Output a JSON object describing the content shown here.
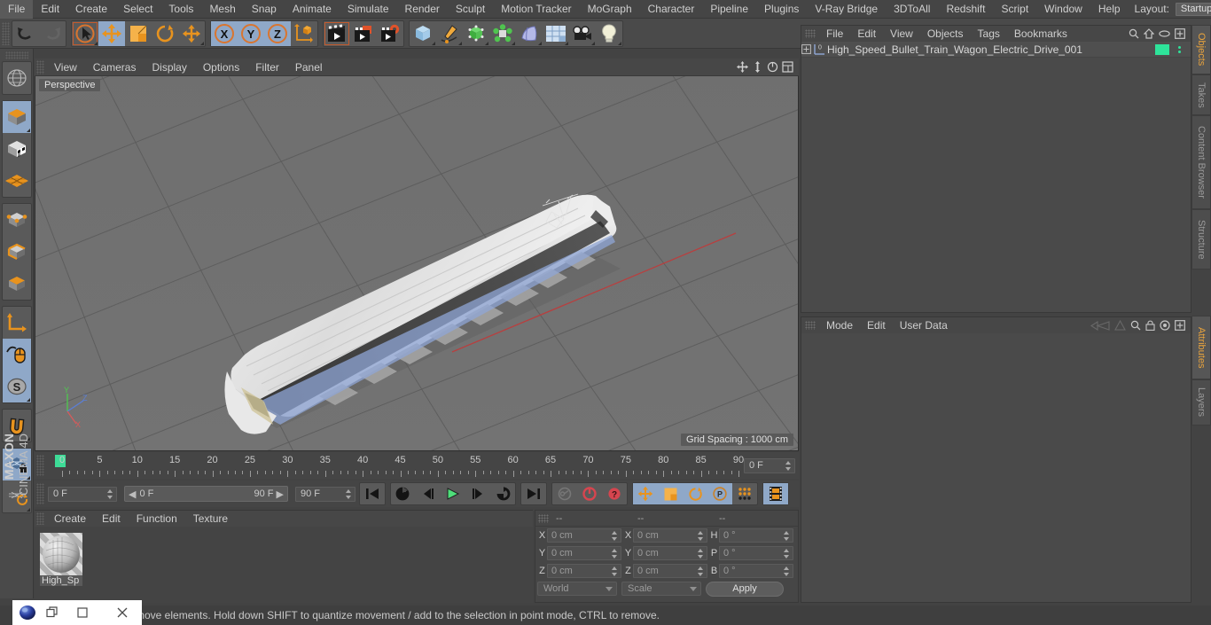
{
  "menubar": {
    "items": [
      "File",
      "Edit",
      "Create",
      "Select",
      "Tools",
      "Mesh",
      "Snap",
      "Animate",
      "Simulate",
      "Render",
      "Sculpt",
      "Motion Tracker",
      "MoGraph",
      "Character",
      "Pipeline",
      "Plugins",
      "V-Ray Bridge",
      "3DToAll",
      "Redshift",
      "Script",
      "Window",
      "Help"
    ],
    "layout_label": "Layout:",
    "layout_value": "Startup",
    "search_icon": "search-icon"
  },
  "toolbar": {
    "groups": [
      {
        "name": "history",
        "buttons": [
          {
            "name": "undo-button",
            "icon": "undo-arrow-icon",
            "state": "normal"
          },
          {
            "name": "redo-button",
            "icon": "redo-arrow-icon",
            "state": "disabled"
          }
        ]
      },
      {
        "name": "tools",
        "buttons": [
          {
            "name": "live-selection-tool",
            "icon": "cursor-circle-icon",
            "state": "selected"
          },
          {
            "name": "move-tool",
            "icon": "move-arrows-icon",
            "state": "active"
          },
          {
            "name": "scale-tool",
            "icon": "scale-box-icon",
            "state": "normal"
          },
          {
            "name": "rotate-tool",
            "icon": "rotate-circle-icon",
            "state": "normal"
          },
          {
            "name": "move-duplicate-tool",
            "icon": "move-arrows-icon",
            "state": "normal"
          }
        ]
      },
      {
        "name": "axis-locks",
        "buttons": [
          {
            "name": "lock-x-axis",
            "icon": "x-axis-icon",
            "state": "active"
          },
          {
            "name": "lock-y-axis",
            "icon": "y-axis-icon",
            "state": "active"
          },
          {
            "name": "lock-z-axis",
            "icon": "z-axis-icon",
            "state": "active"
          },
          {
            "name": "world-object-coordinate",
            "icon": "world-axis-cube-icon",
            "state": "normal"
          }
        ]
      },
      {
        "name": "render",
        "buttons": [
          {
            "name": "render-view-button",
            "icon": "clapperboard-icon",
            "state": "selected"
          },
          {
            "name": "render-to-picture-viewer-button",
            "icon": "clapperboard-orange-icon",
            "state": "normal"
          },
          {
            "name": "edit-render-settings-button",
            "icon": "clapperboard-gear-icon",
            "state": "normal"
          }
        ]
      },
      {
        "name": "create",
        "buttons": [
          {
            "name": "add-cube-button",
            "icon": "blue-cube-icon",
            "state": "normal"
          },
          {
            "name": "add-spline-button",
            "icon": "pen-spline-icon",
            "state": "normal"
          },
          {
            "name": "add-generator-button",
            "icon": "green-cube-icon",
            "state": "normal"
          },
          {
            "name": "add-mograph-button",
            "icon": "green-cluster-icon",
            "state": "normal"
          },
          {
            "name": "add-deformer-button",
            "icon": "purple-bend-icon",
            "state": "normal"
          },
          {
            "name": "add-scene-button",
            "icon": "floor-grid-icon",
            "state": "normal"
          },
          {
            "name": "add-camera-button",
            "icon": "camera-icon",
            "state": "normal"
          },
          {
            "name": "add-light-button",
            "icon": "lightbulb-icon",
            "state": "normal"
          }
        ]
      }
    ]
  },
  "lefttool": {
    "groups": [
      [
        {
          "name": "undo-view-button",
          "icon": "globe-wire-icon",
          "state": "normal"
        }
      ],
      [
        {
          "name": "model-mode-button",
          "icon": "cube-solid-icon",
          "state": "active"
        },
        {
          "name": "texture-mode-button",
          "icon": "cube-checker-icon",
          "state": "normal"
        },
        {
          "name": "workplane-mode-button",
          "icon": "orange-grid-icon",
          "state": "normal"
        }
      ],
      [
        {
          "name": "points-mode-button",
          "icon": "cube-points-icon",
          "state": "normal"
        },
        {
          "name": "edges-mode-button",
          "icon": "cube-edges-icon",
          "state": "normal"
        },
        {
          "name": "polygons-mode-button",
          "icon": "cube-polys-icon",
          "state": "normal"
        }
      ],
      [
        {
          "name": "enable-axis-button",
          "icon": "axis-corner-icon",
          "state": "normal"
        },
        {
          "name": "viewport-solo-button",
          "icon": "mouse-cursor-icon",
          "state": "active"
        },
        {
          "name": "enable-snapping-button",
          "icon": "snap-s-icon",
          "state": "active"
        }
      ],
      [
        {
          "name": "magnet-tool-button",
          "icon": "magnet-icon",
          "state": "normal"
        }
      ],
      [
        {
          "name": "lock-workplane-button",
          "icon": "grid-lock-icon",
          "state": "active"
        },
        {
          "name": "planar-workplane-button",
          "icon": "grid-rotate-icon",
          "state": "normal"
        }
      ]
    ],
    "brand_top": "MAXON",
    "brand_bottom": "CINEMA 4D"
  },
  "viewport": {
    "menu": [
      "View",
      "Cameras",
      "Display",
      "Options",
      "Filter",
      "Panel"
    ],
    "corner_icons": [
      "pan-icon",
      "dolly-icon",
      "rotate-icon",
      "maximize-icon"
    ],
    "view_label": "Perspective",
    "grid_spacing": "Grid Spacing : 1000 cm",
    "axis_labels": {
      "x": "X",
      "y": "Y",
      "z": "Z"
    },
    "scene_object": "High Speed Bullet Train Wagon"
  },
  "timeline": {
    "frame_labels": [
      "0",
      "5",
      "10",
      "15",
      "20",
      "25",
      "30",
      "35",
      "40",
      "45",
      "50",
      "55",
      "60",
      "65",
      "70",
      "75",
      "80",
      "85",
      "90"
    ],
    "current_frame_field": "0 F",
    "start_value": "0",
    "end_value": "90"
  },
  "transport": {
    "current_frame": "0 F",
    "range_start": "0 F",
    "range_end": "90 F",
    "end_frame": "90 F",
    "buttons": [
      {
        "name": "go-to-start-button",
        "icon": "skip-start-icon"
      },
      {
        "name": "play-backwards-button",
        "icon": "rewind-loop-icon"
      },
      {
        "name": "previous-frame-button",
        "icon": "step-back-icon"
      },
      {
        "name": "play-forwards-button",
        "icon": "play-icon"
      },
      {
        "name": "next-frame-button",
        "icon": "step-forward-icon"
      },
      {
        "name": "play-forwards-loop-button",
        "icon": "forward-loop-icon"
      },
      {
        "name": "go-to-end-button",
        "icon": "skip-end-icon"
      },
      {
        "name": "record-active-objects-button",
        "icon": "key-icon"
      },
      {
        "name": "autokeying-button",
        "icon": "red-circle-icon"
      },
      {
        "name": "keyframe-selection-button",
        "icon": "red-question-icon"
      },
      {
        "name": "position-key-button",
        "icon": "move-arrows-icon"
      },
      {
        "name": "scale-key-button",
        "icon": "scale-box-icon"
      },
      {
        "name": "rotation-key-button",
        "icon": "rotate-circle-icon"
      },
      {
        "name": "param-key-button",
        "icon": "p-circle-icon"
      },
      {
        "name": "point-level-animation-button",
        "icon": "dots-grid-icon"
      },
      {
        "name": "animation-mode-button",
        "icon": "filmstrip-icon"
      }
    ]
  },
  "material_manager": {
    "menu": [
      "Create",
      "Edit",
      "Function",
      "Texture"
    ],
    "materials": [
      {
        "name": "High_Sp",
        "label": "High_Sp"
      }
    ]
  },
  "coordinates": {
    "headers": [
      "--",
      "--",
      "--"
    ],
    "rows": [
      {
        "l1": "X",
        "v1": "0 cm",
        "l2": "X",
        "v2": "0 cm",
        "l3": "H",
        "v3": "0 °"
      },
      {
        "l1": "Y",
        "v1": "0 cm",
        "l2": "Y",
        "v2": "0 cm",
        "l3": "P",
        "v3": "0 °"
      },
      {
        "l1": "Z",
        "v1": "0 cm",
        "l2": "Z",
        "v2": "0 cm",
        "l3": "B",
        "v3": "0 °"
      }
    ],
    "system_select": "World",
    "mode_select": "Scale",
    "apply_label": "Apply"
  },
  "object_manager": {
    "menu": [
      "File",
      "Edit",
      "View",
      "Objects",
      "Tags",
      "Bookmarks"
    ],
    "icons": [
      "search-icon",
      "home-icon",
      "ellipse-icon",
      "plus-box-icon"
    ],
    "objects": [
      {
        "expander": "+",
        "layer_badge": "0",
        "name": "High_Speed_Bullet_Train_Wagon_Electric_Drive_001",
        "tag_color": "#2ee39a"
      }
    ]
  },
  "attribute_manager": {
    "menu": [
      "Mode",
      "Edit",
      "User Data"
    ],
    "icons": [
      "left-arrow-icon",
      "up-arrow-icon",
      "search-icon",
      "lock-icon",
      "target-icon",
      "plus-box-icon"
    ]
  },
  "right_tabs": {
    "top": [
      "Objects",
      "Takes",
      "Content Browser",
      "Structure"
    ],
    "bottom": [
      "Attributes",
      "Layers"
    ],
    "active_top": "Objects",
    "active_bottom": "Attributes"
  },
  "statusbar": {
    "message": "move elements. Hold down SHIFT to quantize movement / add to the selection in point mode, CTRL to remove."
  },
  "window_controls": {
    "app_icon": "cinema4d-icon",
    "restore": "❐",
    "minimize": "▭",
    "close": "✕"
  },
  "colors": {
    "accent_orange": "#e8a33d",
    "active_blue": "#8fa8c8",
    "tag_green": "#2ee39a",
    "panel_bg": "#4a4a4a",
    "viewport_bg": "#6e6e6e"
  }
}
